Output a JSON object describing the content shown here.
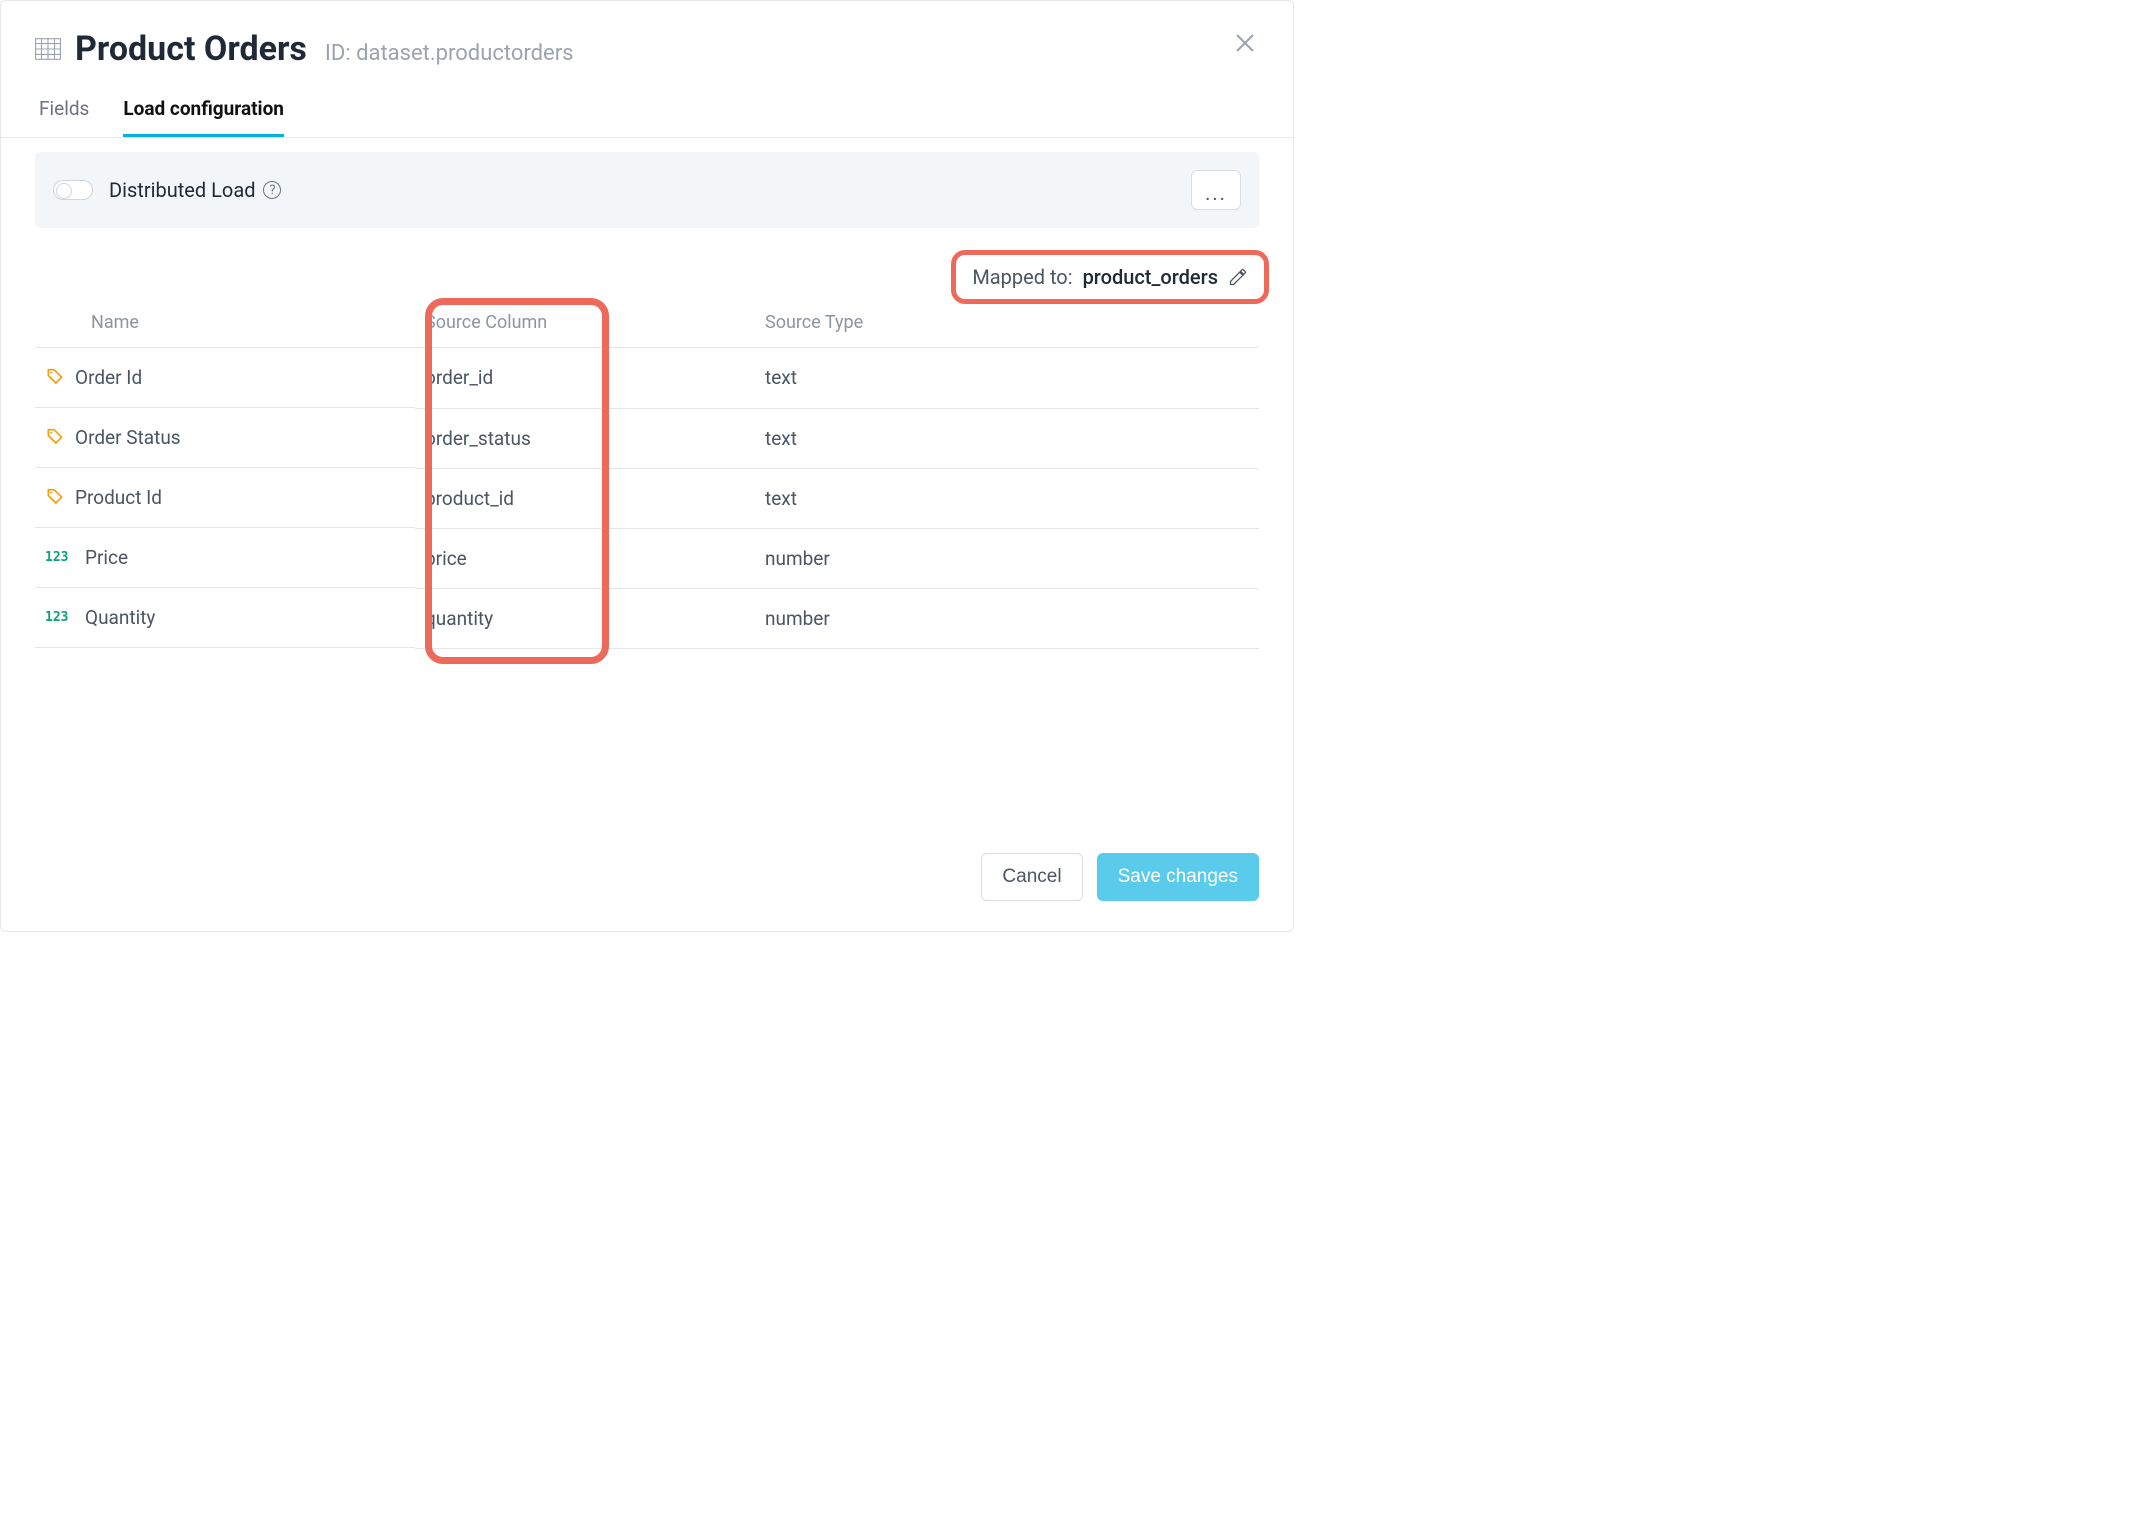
{
  "header": {
    "title": "Product Orders",
    "id_label": "ID: dataset.productorders"
  },
  "tabs": {
    "fields": "Fields",
    "load_config": "Load configuration"
  },
  "distributed": {
    "label": "Distributed Load",
    "more": "..."
  },
  "mapped": {
    "label": "Mapped to:",
    "value": "product_orders"
  },
  "columns": {
    "name": "Name",
    "source_column": "Source Column",
    "source_type": "Source Type"
  },
  "rows": [
    {
      "icon": "tag",
      "name": "Order Id",
      "source_column": "order_id",
      "source_type": "text"
    },
    {
      "icon": "tag",
      "name": "Order Status",
      "source_column": "order_status",
      "source_type": "text"
    },
    {
      "icon": "tag",
      "name": "Product Id",
      "source_column": "product_id",
      "source_type": "text"
    },
    {
      "icon": "num",
      "name": "Price",
      "source_column": "price",
      "source_type": "number"
    },
    {
      "icon": "num",
      "name": "Quantity",
      "source_column": "quantity",
      "source_type": "number"
    }
  ],
  "num_badge": "123",
  "footer": {
    "cancel": "Cancel",
    "save": "Save changes"
  }
}
